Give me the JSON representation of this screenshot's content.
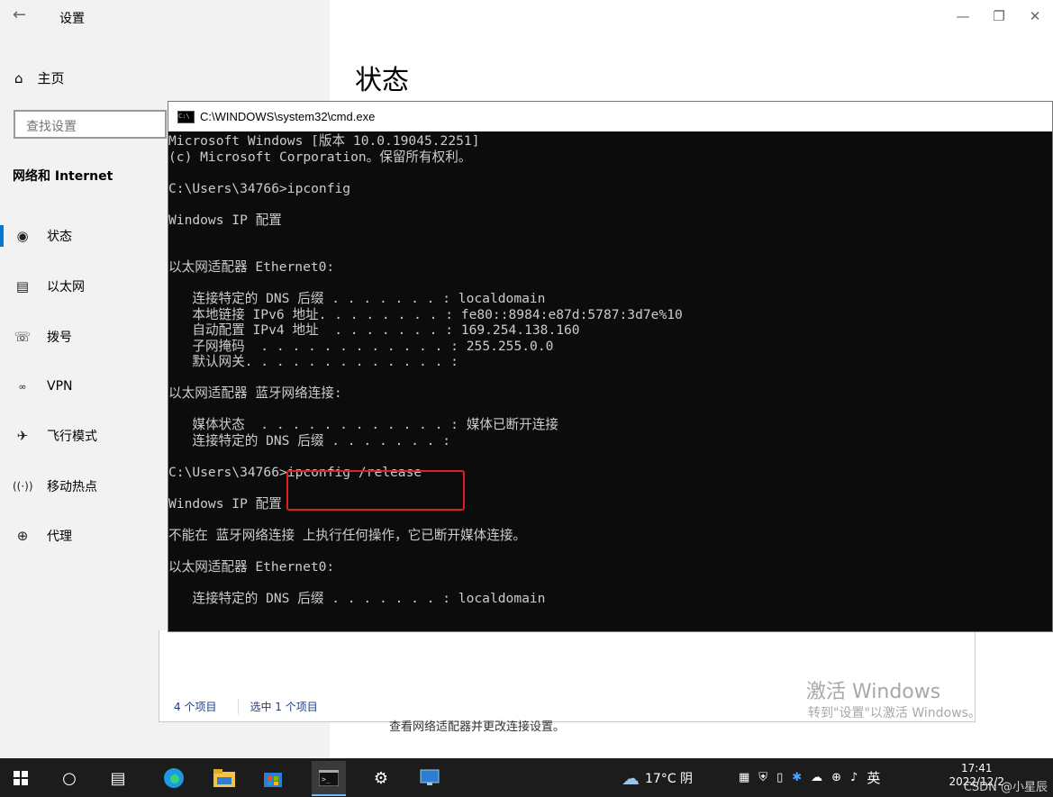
{
  "settings": {
    "app_title": "设置",
    "page_title": "状态",
    "home_label": "主页",
    "search_placeholder": "查找设置",
    "section_header": "网络和 Internet",
    "nav_items": [
      {
        "label": "状态",
        "icon": "globe-icon"
      },
      {
        "label": "以太网",
        "icon": "ethernet-icon"
      },
      {
        "label": "拨号",
        "icon": "dialup-icon"
      },
      {
        "label": "VPN",
        "icon": "vpn-icon"
      },
      {
        "label": "飞行模式",
        "icon": "airplane-icon"
      },
      {
        "label": "移动热点",
        "icon": "hotspot-icon"
      },
      {
        "label": "代理",
        "icon": "proxy-globe-icon"
      }
    ],
    "bottom_tip": "查看网络适配器并更改连接设置。"
  },
  "explorer": {
    "item_count": "4 个项目",
    "selected_count": "选中 1 个项目"
  },
  "activation": {
    "line1": "激活 Windows",
    "line2": "转到\"设置\"以激活 Windows。"
  },
  "cmd": {
    "title": "C:\\WINDOWS\\system32\\cmd.exe",
    "lines": [
      "Microsoft Windows [版本 10.0.19045.2251]",
      "(c) Microsoft Corporation。保留所有权利。",
      "",
      "C:\\Users\\34766>ipconfig",
      "",
      "Windows IP 配置",
      "",
      "",
      "以太网适配器 Ethernet0:",
      "",
      "   连接特定的 DNS 后缀 . . . . . . . : localdomain",
      "   本地链接 IPv6 地址. . . . . . . . : fe80::8984:e87d:5787:3d7e%10",
      "   自动配置 IPv4 地址  . . . . . . . : 169.254.138.160",
      "   子网掩码  . . . . . . . . . . . . : 255.255.0.0",
      "   默认网关. . . . . . . . . . . . . :",
      "",
      "以太网适配器 蓝牙网络连接:",
      "",
      "   媒体状态  . . . . . . . . . . . . : 媒体已断开连接",
      "   连接特定的 DNS 后缀 . . . . . . . :",
      "",
      "C:\\Users\\34766>ipconfig /release",
      "",
      "Windows IP 配置",
      "",
      "不能在 蓝牙网络连接 上执行任何操作，它已断开媒体连接。",
      "",
      "以太网适配器 Ethernet0:",
      "",
      "   连接特定的 DNS 后缀 . . . . . . . : localdomain"
    ]
  },
  "taskbar": {
    "weather": "17°C 阴",
    "ime": "英",
    "time": "17:41",
    "date": "2022/12/2",
    "watermark": "CSDN @小星辰"
  },
  "colors": {
    "accent": "#0078d4",
    "highlight": "#e02020",
    "console_bg": "#0c0c0c",
    "console_fg": "#cccccc"
  }
}
